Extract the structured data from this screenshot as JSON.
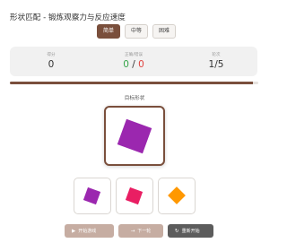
{
  "page": {
    "title": "形状匹配 - 锻炼观察力与反应速度"
  },
  "difficulty": {
    "options": [
      "简单",
      "中等",
      "困难"
    ],
    "selected": "简单"
  },
  "stats": {
    "score_label": "得分",
    "score_value": "0",
    "accuracy_label": "正确/错误",
    "correct_value": "0",
    "separator": "/",
    "wrong_value": "0",
    "round_label": "轮次",
    "round_value": "1/5"
  },
  "progress": {
    "fraction": 0.98
  },
  "target": {
    "label": "目标形状",
    "shape": "square",
    "color": "#9b27af",
    "rotation_deg": 20
  },
  "options": [
    {
      "shape": "square",
      "color": "#9b27af",
      "rotation_deg": 20
    },
    {
      "shape": "square",
      "color": "#e91e63",
      "rotation_deg": 20
    },
    {
      "shape": "diamond",
      "color": "#ff9800",
      "rotation_deg": 45
    }
  ],
  "actions": {
    "start_label": "开始游戏",
    "start_icon": "play-icon",
    "next_label": "下一轮",
    "next_icon": "arrow-right-icon",
    "reset_label": "重新开始",
    "reset_icon": "refresh-icon"
  },
  "colors": {
    "accent": "#7a4f3c",
    "correct": "#37a64a",
    "wrong": "#e0433f"
  }
}
